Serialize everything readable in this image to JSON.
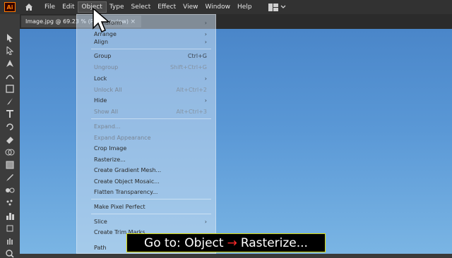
{
  "app": {
    "logo_text": "Ai"
  },
  "menubar": {
    "items": [
      "File",
      "Edit",
      "Object",
      "Type",
      "Select",
      "Effect",
      "View",
      "Window",
      "Help"
    ],
    "active": "Object"
  },
  "document_tab": {
    "title": "Image.jpg @ 69.23 % (RGB/Preview)",
    "close": "×"
  },
  "object_menu": {
    "items": [
      {
        "label": "Transform",
        "shortcut": "",
        "submenu": true,
        "enabled": true
      },
      {
        "label": "Arrange",
        "shortcut": "",
        "submenu": true,
        "enabled": true
      },
      {
        "label": "Align",
        "shortcut": "",
        "submenu": true,
        "enabled": true
      },
      {
        "label": "Group",
        "shortcut": "Ctrl+G",
        "submenu": false,
        "enabled": true
      },
      {
        "label": "Ungroup",
        "shortcut": "Shift+Ctrl+G",
        "submenu": false,
        "enabled": false
      },
      {
        "label": "Lock",
        "shortcut": "",
        "submenu": true,
        "enabled": true
      },
      {
        "label": "Unlock All",
        "shortcut": "Alt+Ctrl+2",
        "submenu": false,
        "enabled": false
      },
      {
        "label": "Hide",
        "shortcut": "",
        "submenu": true,
        "enabled": true
      },
      {
        "label": "Show All",
        "shortcut": "Alt+Ctrl+3",
        "submenu": false,
        "enabled": false
      },
      {
        "label": "Expand...",
        "shortcut": "",
        "submenu": false,
        "enabled": false
      },
      {
        "label": "Expand Appearance",
        "shortcut": "",
        "submenu": false,
        "enabled": false
      },
      {
        "label": "Crop Image",
        "shortcut": "",
        "submenu": false,
        "enabled": true
      },
      {
        "label": "Rasterize...",
        "shortcut": "",
        "submenu": false,
        "enabled": true
      },
      {
        "label": "Create Gradient Mesh...",
        "shortcut": "",
        "submenu": false,
        "enabled": true
      },
      {
        "label": "Create Object Mosaic...",
        "shortcut": "",
        "submenu": false,
        "enabled": true
      },
      {
        "label": "Flatten Transparency...",
        "shortcut": "",
        "submenu": false,
        "enabled": true
      },
      {
        "label": "Make Pixel Perfect",
        "shortcut": "",
        "submenu": false,
        "enabled": true
      },
      {
        "label": "Slice",
        "shortcut": "",
        "submenu": true,
        "enabled": true
      },
      {
        "label": "Create Trim Marks",
        "shortcut": "",
        "submenu": false,
        "enabled": true
      },
      {
        "label": "Path",
        "shortcut": "",
        "submenu": true,
        "enabled": true
      }
    ]
  },
  "caption": {
    "prefix": "Go to: Object",
    "arrow": "→",
    "suffix": "Rasterize..."
  },
  "colors": {
    "accent_logo": "#ff7c00",
    "caption_border": "#d7d700",
    "caption_arrow": "#ff2a2a"
  }
}
